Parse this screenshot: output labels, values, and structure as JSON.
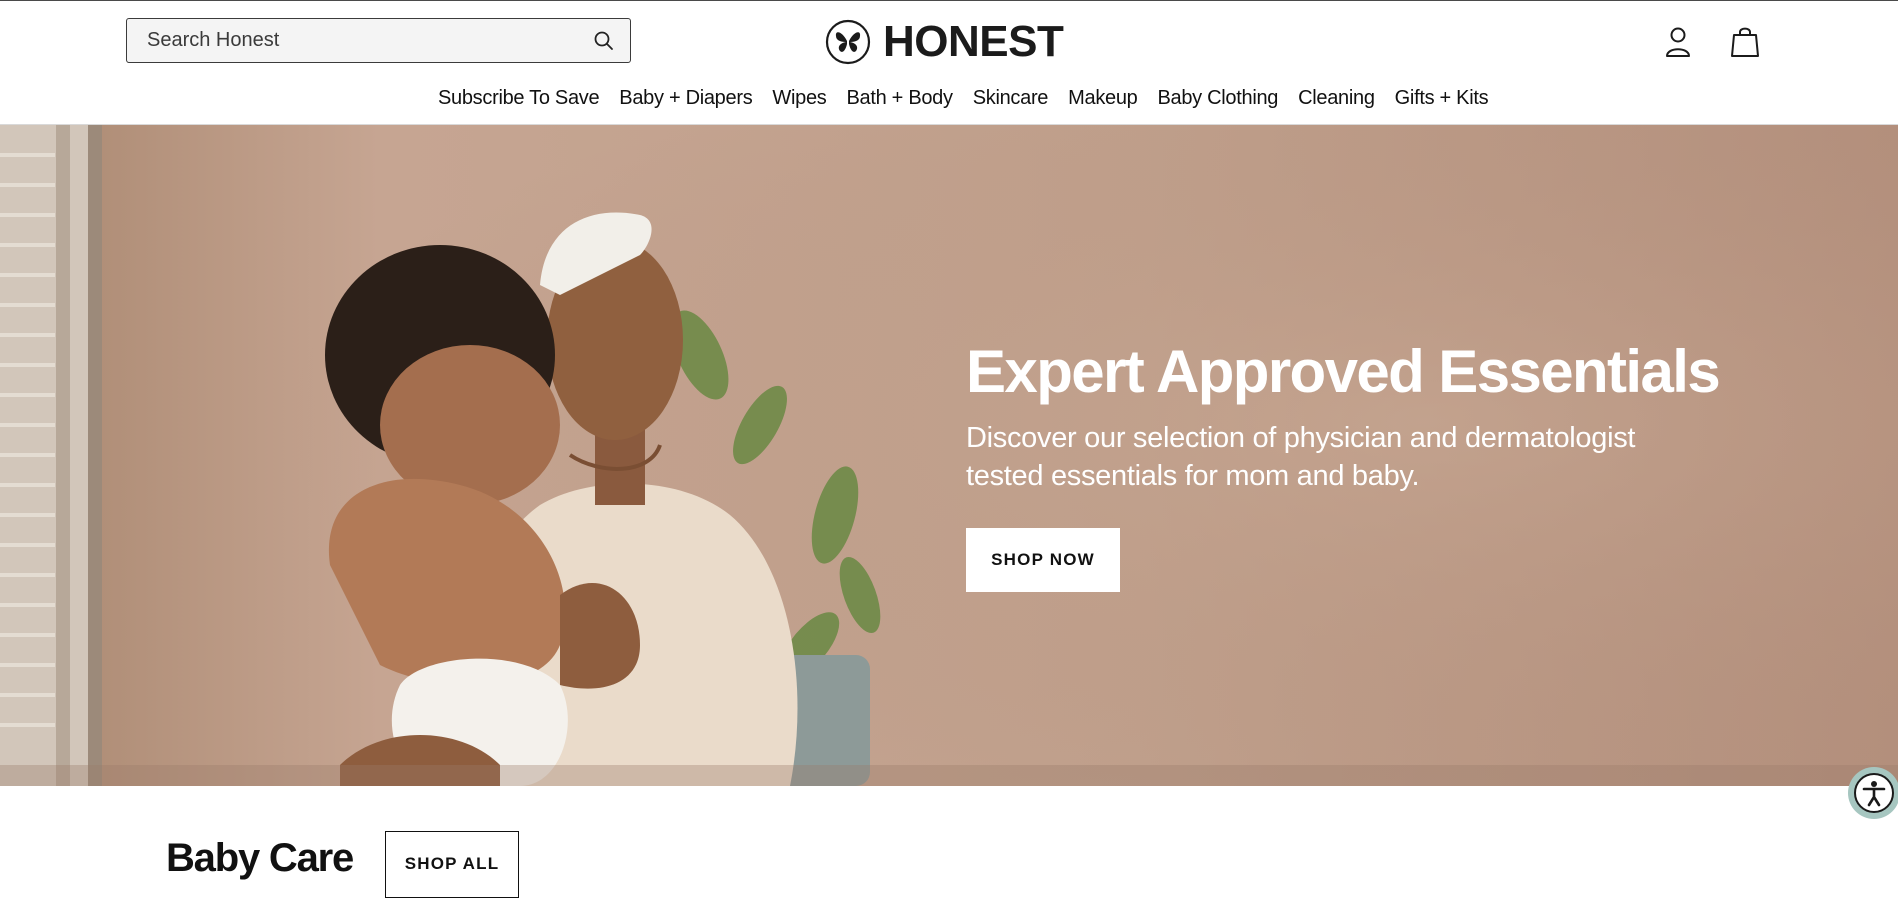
{
  "header": {
    "search": {
      "placeholder": "Search Honest"
    },
    "logo": {
      "text": "HONEST",
      "icon": "butterfly-logo-icon"
    },
    "icons": {
      "search": "search-icon",
      "account": "user-icon",
      "cart": "shopping-bag-icon"
    }
  },
  "nav": {
    "items": [
      "Subscribe To Save",
      "Baby + Diapers",
      "Wipes",
      "Bath + Body",
      "Skincare",
      "Makeup",
      "Baby Clothing",
      "Cleaning",
      "Gifts + Kits"
    ]
  },
  "hero": {
    "title": "Expert Approved Essentials",
    "subtitle_line1": "Discover our selection of physician and dermatologist",
    "subtitle_line2": "tested essentials for mom and baby.",
    "cta": "SHOP NOW"
  },
  "section": {
    "title": "Baby Care",
    "cta": "SHOP ALL"
  },
  "accessibility": {
    "icon": "accessibility-icon"
  },
  "colors": {
    "hero_bg": "#bf9c88",
    "text": "#111111",
    "button_bg": "#ffffff",
    "a11y_ring": "#a6c6c0"
  }
}
